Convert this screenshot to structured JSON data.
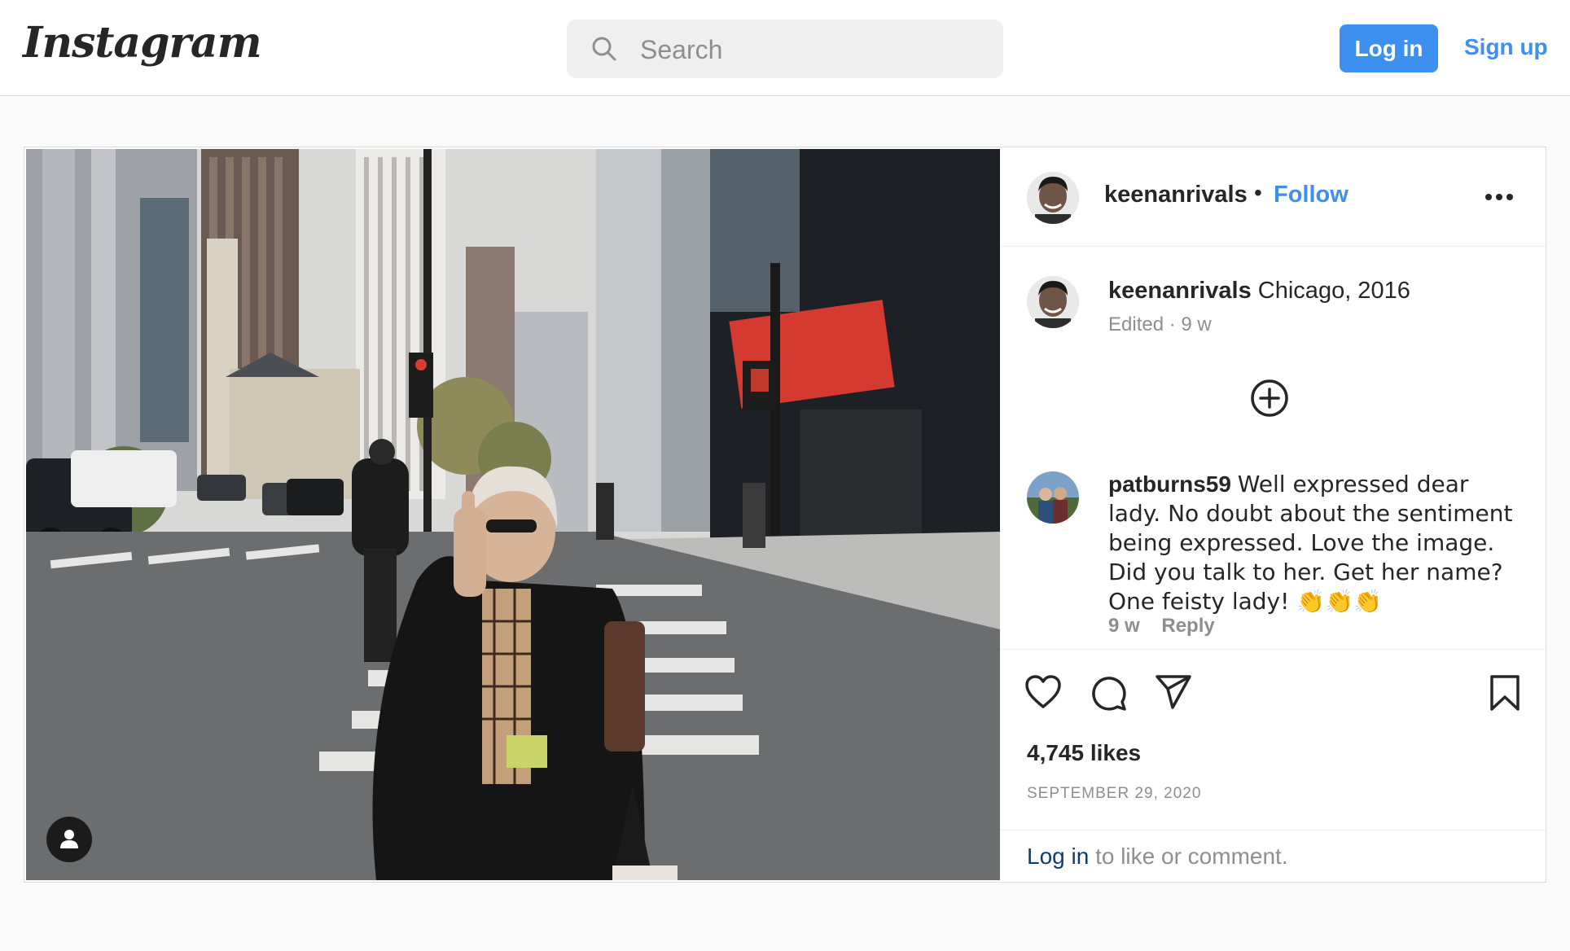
{
  "header": {
    "logo_text": "Instagram",
    "search_placeholder": "Search",
    "login_label": "Log in",
    "signup_label": "Sign up"
  },
  "post": {
    "author": "keenanrivals",
    "follow_label": "Follow",
    "caption": {
      "username": "keenanrivals",
      "text": "Chicago, 2016",
      "meta": "Edited · 9 w"
    },
    "comments": [
      {
        "username": "patburns59",
        "text": "Well expressed dear lady. No doubt about the sentiment being expressed. Love the image. Did you talk to her. Get her name? One feisty lady! 👏👏👏",
        "time": "9 w",
        "reply_label": "Reply"
      }
    ],
    "likes": "4,745 likes",
    "date": "SEPTEMBER 29, 2020",
    "login_prompt": {
      "link": "Log in",
      "rest": " to like or comment."
    }
  },
  "colors": {
    "accent": "#3d8ff0",
    "link_dark": "#0a3d75",
    "muted": "#8e8e8e",
    "text": "#262626",
    "border": "#dbdbdb"
  },
  "icons": [
    "search-icon",
    "more-options-icon",
    "plus-circle-icon",
    "heart-icon",
    "comment-icon",
    "share-icon",
    "bookmark-icon",
    "user-icon"
  ]
}
